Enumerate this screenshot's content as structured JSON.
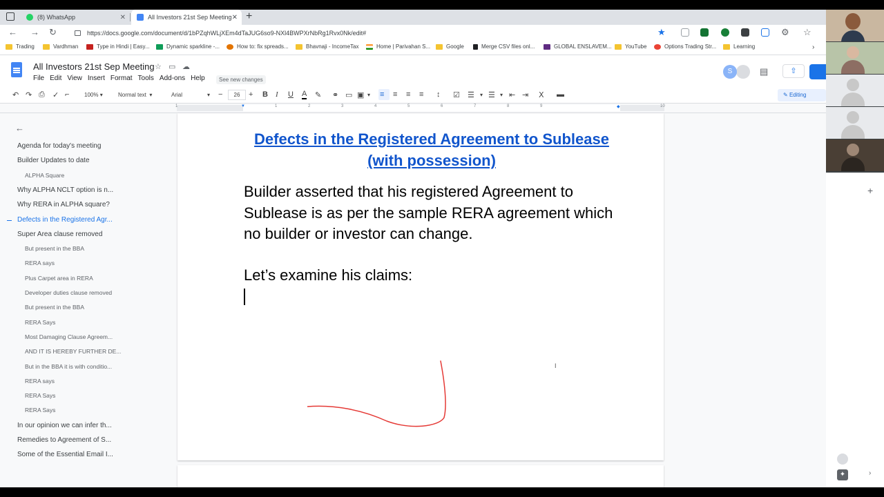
{
  "browser": {
    "tabs": [
      {
        "title": "(8) WhatsApp",
        "active": false
      },
      {
        "title": "All Investors 21st Sep Meeting -",
        "active": true
      }
    ],
    "url": "https://docs.google.com/document/d/1bPZqhWLjXEm4dTaJUG6so9-NXl4BWPXrNbRg1Rvx0Nk/edit#",
    "bookmarks": [
      "Trading",
      "Vardhman",
      "Type in Hindi | Easy...",
      "Dynamic sparkline -...",
      "How to: fix spreads...",
      "Bhavnaji - IncomeTax",
      "Home | Parivahan S...",
      "Google",
      "Merge CSV files onl...",
      "GLOBAL ENSLAVEM...",
      "YouTube",
      "Options Trading Str...",
      "Learning"
    ]
  },
  "doc": {
    "title": "All Investors 21st Sep Meeting",
    "menu": [
      "File",
      "Edit",
      "View",
      "Insert",
      "Format",
      "Tools",
      "Add-ons",
      "Help"
    ],
    "new_changes": "See new changes",
    "avatar_initial": "S"
  },
  "toolbar": {
    "zoom": "100%",
    "style": "Normal text",
    "font": "Arial",
    "font_size": "26",
    "mode": "Editing"
  },
  "ruler": [
    "1",
    "1",
    "2",
    "3",
    "4",
    "5",
    "6",
    "7",
    "8",
    "9",
    "10"
  ],
  "outline": [
    {
      "label": "Agenda for today's meeting",
      "level": 1,
      "active": false
    },
    {
      "label": "Builder Updates to date",
      "level": 1,
      "active": false
    },
    {
      "label": "ALPHA Square",
      "level": 2,
      "active": false
    },
    {
      "label": "Why ALPHA NCLT option is n...",
      "level": 1,
      "active": false
    },
    {
      "label": "Why RERA in ALPHA square?",
      "level": 1,
      "active": false
    },
    {
      "label": "Defects in the Registered Agr...",
      "level": 1,
      "active": true
    },
    {
      "label": "Super Area clause removed",
      "level": 1,
      "active": false
    },
    {
      "label": "But present in the BBA",
      "level": 2,
      "active": false
    },
    {
      "label": "RERA says",
      "level": 2,
      "active": false
    },
    {
      "label": "Plus Carpet area in RERA",
      "level": 2,
      "active": false
    },
    {
      "label": "Developer duties clause removed",
      "level": 2,
      "active": false
    },
    {
      "label": "But present in the BBA",
      "level": 2,
      "active": false
    },
    {
      "label": "RERA Says",
      "level": 2,
      "active": false
    },
    {
      "label": "Most Damaging Clause Agreem...",
      "level": 2,
      "active": false
    },
    {
      "label": "AND IT IS HEREBY FURTHER DE...",
      "level": 2,
      "active": false
    },
    {
      "label": "But in the BBA it is with conditio...",
      "level": 2,
      "active": false
    },
    {
      "label": "RERA says",
      "level": 2,
      "active": false
    },
    {
      "label": "RERA Says",
      "level": 2,
      "active": false
    },
    {
      "label": "RERA Says",
      "level": 2,
      "active": false
    },
    {
      "label": "In our opinion we can infer th...",
      "level": 1,
      "active": false
    },
    {
      "label": "Remedies to Agreement of S...",
      "level": 1,
      "active": false
    },
    {
      "label": "Some of the Essential Email I...",
      "level": 1,
      "active": false
    }
  ],
  "page": {
    "heading": "Defects in the Registered Agreement to Sublease (with possession)",
    "paragraph": "Builder asserted that his registered Agreement to Sublease is as per the sample RERA agreement which no builder or investor can change.",
    "paragraph2": "Let’s examine his claims:"
  },
  "colors": {
    "accent": "#1a73e8",
    "heading_link": "#1155cc",
    "annotation": "#e53935"
  }
}
